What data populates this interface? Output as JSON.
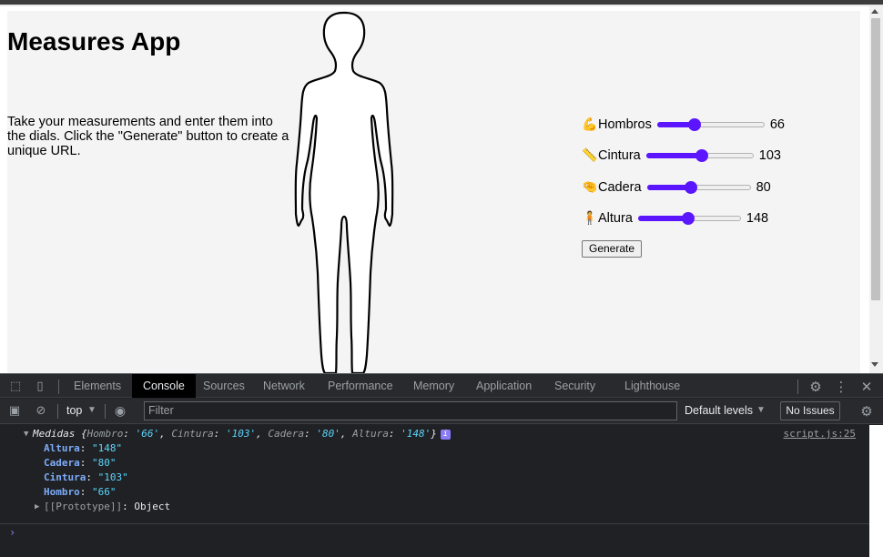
{
  "page": {
    "title": "Measures App",
    "intro": "Take your measurements and enter them into the dials. Click the \"Generate\" button to create a unique URL.",
    "generate_label": "Generate",
    "accent_color": "#5b16ff"
  },
  "measures": [
    {
      "emoji": "💪",
      "label": "Hombros",
      "value": "66",
      "fill_fraction": 0.35
    },
    {
      "emoji": "📏",
      "label": "Cintura",
      "value": "103",
      "fill_fraction": 0.52
    },
    {
      "emoji": "🤏",
      "label": "Cadera",
      "value": "80",
      "fill_fraction": 0.42
    },
    {
      "emoji": "🧍",
      "label": "Altura",
      "value": "148",
      "fill_fraction": 0.49
    }
  ],
  "devtools": {
    "tabs": [
      "Elements",
      "Console",
      "Sources",
      "Network",
      "Performance",
      "Memory",
      "Application",
      "Security",
      "Lighthouse"
    ],
    "active_tab": "Console",
    "context": "top",
    "filter_placeholder": "Filter",
    "levels": "Default levels",
    "issues": "No Issues",
    "source_link": "script.js:25",
    "log": {
      "object_name": "Medidas",
      "summary": [
        {
          "key": "Hombro",
          "value": "'66'"
        },
        {
          "key": "Cintura",
          "value": "'103'"
        },
        {
          "key": "Cadera",
          "value": "'80'"
        },
        {
          "key": "Altura",
          "value": "'148'"
        }
      ],
      "properties": [
        {
          "key": "Altura",
          "value": "\"148\""
        },
        {
          "key": "Cadera",
          "value": "\"80\""
        },
        {
          "key": "Cintura",
          "value": "\"103\""
        },
        {
          "key": "Hombro",
          "value": "\"66\""
        }
      ],
      "prototype_key": "[[Prototype]]",
      "prototype_value": "Object"
    },
    "prompt": "›"
  }
}
